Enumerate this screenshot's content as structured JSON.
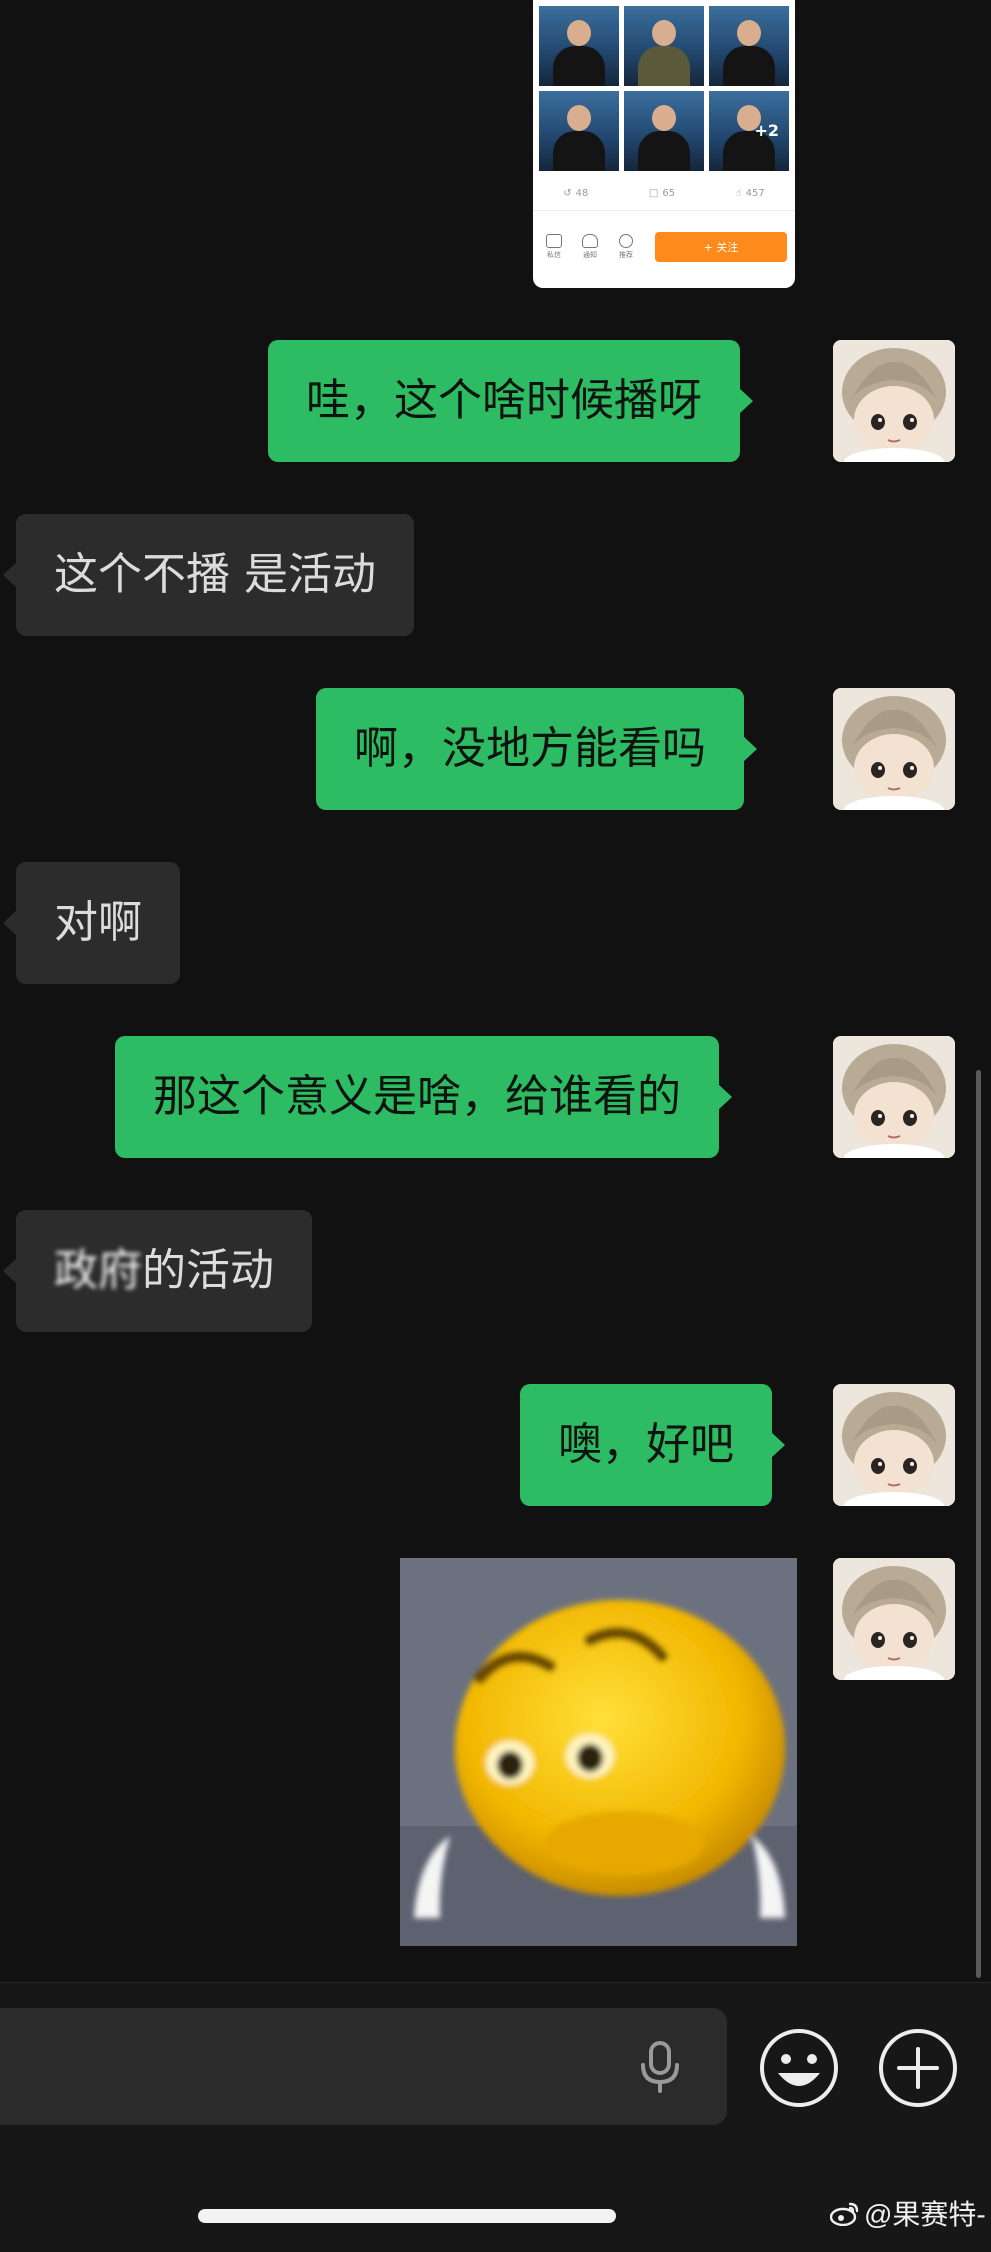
{
  "chat": {
    "shared_card": {
      "more_badge": "+2",
      "stats": {
        "reposts": "48",
        "comments": "65",
        "likes": "457"
      },
      "toolbar": {
        "item1": "私信",
        "item2": "通知",
        "item3": "推荐",
        "follow_label": "+ 关注"
      }
    },
    "messages": [
      {
        "side": "sent",
        "text": "哇，这个啥时候播呀"
      },
      {
        "side": "received",
        "text": "这个不播 是活动"
      },
      {
        "side": "sent",
        "text": "啊，没地方能看吗"
      },
      {
        "side": "received",
        "text": "对啊"
      },
      {
        "side": "sent",
        "text": "那这个意义是啥，给谁看的"
      },
      {
        "side": "received",
        "blurred_text": "政府",
        "text": "的活动"
      },
      {
        "side": "sent",
        "text": "噢，好吧"
      }
    ]
  },
  "input_bar": {
    "voice_icon": "microphone-icon",
    "emoji_icon": "smiley-face-icon",
    "more_icon": "plus-circle-icon"
  },
  "watermark": {
    "text": "@果赛特-",
    "logo_icon": "weibo-logo-icon"
  },
  "colors": {
    "background": "#111111",
    "sent_bubble": "#2dbc63",
    "received_bubble": "#2c2c2c",
    "follow_button": "#ff8a1c"
  }
}
